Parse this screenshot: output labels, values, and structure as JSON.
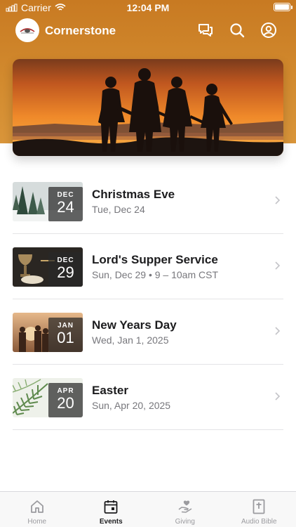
{
  "status_bar": {
    "carrier": "Carrier",
    "time": "12:04 PM"
  },
  "app_bar": {
    "title": "Cornerstone"
  },
  "events": [
    {
      "month": "DEC",
      "day": "24",
      "title": "Christmas Eve",
      "subtitle": "Tue, Dec 24",
      "thumb": "forest"
    },
    {
      "month": "DEC",
      "day": "29",
      "title": "Lord's Supper Service",
      "subtitle": "Sun, Dec 29 • 9 – 10am CST",
      "thumb": "supper"
    },
    {
      "month": "JAN",
      "day": "01",
      "title": "New Years Day",
      "subtitle": "Wed, Jan 1, 2025",
      "thumb": "sunset"
    },
    {
      "month": "APR",
      "day": "20",
      "title": "Easter",
      "subtitle": "Sun, Apr 20, 2025",
      "thumb": "palm"
    }
  ],
  "tabs": [
    {
      "label": "Home",
      "icon": "home-icon",
      "active": false
    },
    {
      "label": "Events",
      "icon": "calendar-icon",
      "active": true
    },
    {
      "label": "Giving",
      "icon": "giving-heart-hand-icon",
      "active": false
    },
    {
      "label": "Audio Bible",
      "icon": "bible-icon",
      "active": false
    }
  ],
  "colors": {
    "brand": "#d08528",
    "text": "#1c1c1e",
    "muted": "#77777c",
    "tab_inactive": "#9b9b9f"
  }
}
